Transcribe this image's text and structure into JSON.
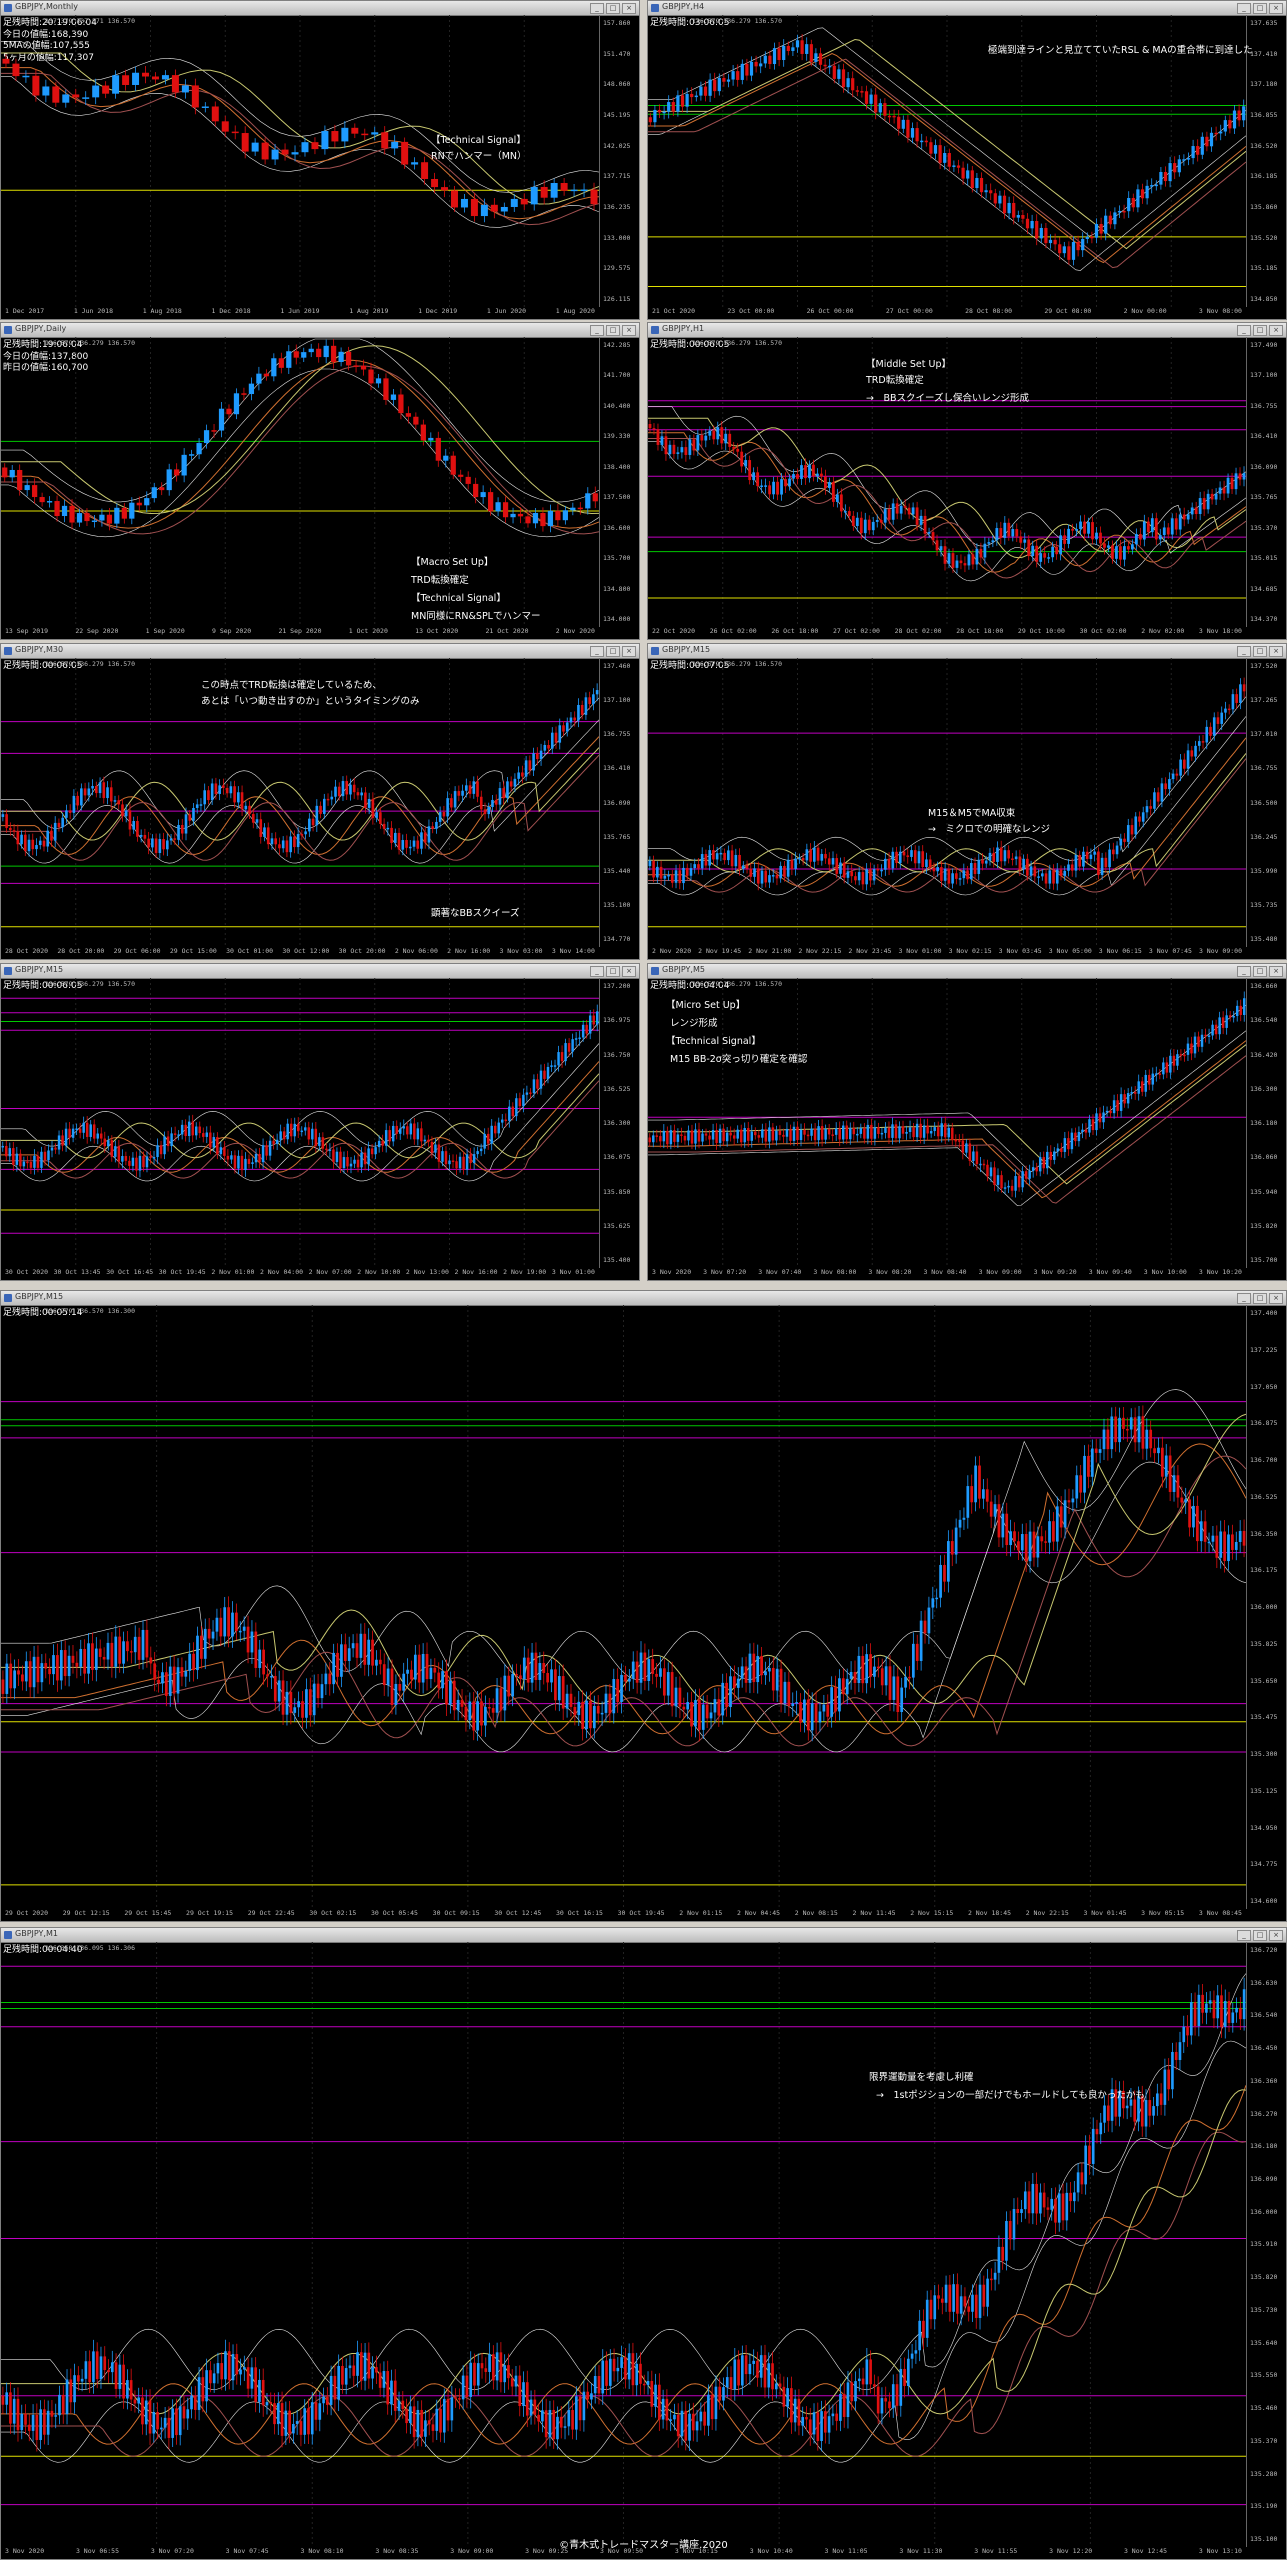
{
  "panels": [
    {
      "id": "monthly",
      "title": "GBPJPY,Monthly",
      "info": [
        "足残時間:20:19:06:04",
        "今日の値幅:168,390",
        "5MAの値幅:107,555",
        "5ヶ月の値幅:117,307"
      ],
      "ohlc": "137.379 137.571 136.570",
      "x_labels": [
        "1 Dec 2017",
        "1 Jun 2018",
        "1 Aug 2018",
        "1 Dec 2018",
        "1 Jun 2019",
        "1 Aug 2019",
        "1 Dec 2019",
        "1 Jun 2020",
        "1 Aug 2020"
      ],
      "y_labels": [
        "157.860",
        "151.470",
        "148.060",
        "145.195",
        "142.025",
        "137.715",
        "136.235",
        "133.000",
        "129.575",
        "126.115"
      ],
      "notes": [
        "【Technical Signal】",
        "RNでハンマー（MN）"
      ]
    },
    {
      "id": "h4",
      "title": "GBPJPY,H4",
      "info": [
        "足残時間:03:06:05"
      ],
      "ohlc": "136.579 136.279 136.570",
      "x_labels": [
        "21 Oct 2020",
        "23 Oct 00:00",
        "26 Oct 00:00",
        "27 Oct 00:00",
        "28 Oct 08:00",
        "29 Oct 08:00",
        "2 Nov 00:00",
        "3 Nov 08:00"
      ],
      "y_labels": [
        "137.635",
        "137.410",
        "137.180",
        "136.855",
        "136.520",
        "136.185",
        "135.860",
        "135.520",
        "135.185",
        "134.850"
      ],
      "notes": [
        "極端到達ラインと見立てていたRSL & MAの重合帯に到達した"
      ]
    },
    {
      "id": "daily",
      "title": "GBPJPY,Daily",
      "info": [
        "足残時間:19:06:04",
        "今日の値幅:137,800",
        "昨日の値幅:160,700"
      ],
      "ohlc": "136.579 136.279 136.570",
      "x_labels": [
        "13 Sep 2019",
        "22 Sep 2020",
        "1 Sep 2020",
        "9 Sep 2020",
        "21 Sep 2020",
        "1 Oct 2020",
        "13 Oct 2020",
        "21 Oct 2020",
        "2 Nov 2020"
      ],
      "y_labels": [
        "142.285",
        "141.700",
        "140.400",
        "139.330",
        "138.400",
        "137.500",
        "136.600",
        "135.700",
        "134.800",
        "134.000"
      ],
      "notes": [
        "【Macro Set Up】",
        "TRD転換確定",
        "【Technical Signal】",
        "MN同様にRN&SPLでハンマー"
      ]
    },
    {
      "id": "h1",
      "title": "GBPJPY,H1",
      "info": [
        "足残時間:00:06:05"
      ],
      "ohlc": "136.579 136.279 136.570",
      "x_labels": [
        "22 Oct 2020",
        "26 Oct 02:00",
        "26 Oct 18:00",
        "27 Oct 02:00",
        "28 Oct 02:00",
        "28 Oct 18:00",
        "29 Oct 10:00",
        "30 Oct 02:00",
        "2 Nov 02:00",
        "3 Nov 18:00"
      ],
      "y_labels": [
        "137.490",
        "137.100",
        "136.755",
        "136.410",
        "136.090",
        "135.765",
        "135.370",
        "135.015",
        "134.685",
        "134.370"
      ],
      "notes": [
        "【Middle Set Up】",
        "TRD転換確定",
        "→　BBスクイーズし保合いレンジ形成"
      ]
    },
    {
      "id": "m30",
      "title": "GBPJPY,M30",
      "info": [
        "足残時間:00:06:05"
      ],
      "ohlc": "136.579 136.279 136.570",
      "x_labels": [
        "28 Oct 2020",
        "28 Oct 20:00",
        "29 Oct 06:00",
        "29 Oct 15:00",
        "30 Oct 01:00",
        "30 Oct 12:00",
        "30 Oct 20:00",
        "2 Nov 06:00",
        "2 Nov 16:00",
        "3 Nov 03:00",
        "3 Nov 14:00"
      ],
      "y_labels": [
        "137.460",
        "137.100",
        "136.755",
        "136.410",
        "136.090",
        "135.765",
        "135.440",
        "135.100",
        "134.770"
      ],
      "notes": [
        "この時点でTRD転換は確定しているため、",
        "あとは「いつ動き出すのか」というタイミングのみ",
        "顕著なBBスクイーズ"
      ]
    },
    {
      "id": "m15top",
      "title": "GBPJPY,M15",
      "info": [
        "足残時間:00:07:05"
      ],
      "ohlc": "136.579 136.279 136.570",
      "x_labels": [
        "2 Nov 2020",
        "2 Nov 19:45",
        "2 Nov 21:00",
        "2 Nov 22:15",
        "2 Nov 23:45",
        "3 Nov 01:00",
        "3 Nov 02:15",
        "3 Nov 03:45",
        "3 Nov 05:00",
        "3 Nov 06:15",
        "3 Nov 07:45",
        "3 Nov 09:00"
      ],
      "y_labels": [
        "137.520",
        "137.265",
        "137.010",
        "136.755",
        "136.500",
        "136.245",
        "135.990",
        "135.735",
        "135.480"
      ],
      "notes": [
        "M15＆M5でMA収束",
        "→　ミクロでの明確なレンジ"
      ]
    },
    {
      "id": "m15",
      "title": "GBPJPY,M15",
      "info": [
        "足残時間:00:06:05"
      ],
      "ohlc": "136.579 136.279 136.570",
      "x_labels": [
        "30 Oct 2020",
        "30 Oct 13:45",
        "30 Oct 16:45",
        "30 Oct 19:45",
        "2 Nov 01:00",
        "2 Nov 04:00",
        "2 Nov 07:00",
        "2 Nov 10:00",
        "2 Nov 13:00",
        "2 Nov 16:00",
        "2 Nov 19:00",
        "3 Nov 01:00"
      ],
      "y_labels": [
        "137.200",
        "136.975",
        "136.750",
        "136.525",
        "136.300",
        "136.075",
        "135.850",
        "135.625",
        "135.400"
      ],
      "notes": []
    },
    {
      "id": "m5",
      "title": "GBPJPY,M5",
      "info": [
        "足残時間:00:04:04"
      ],
      "ohlc": "136.579 136.279 136.570",
      "x_labels": [
        "3 Nov 2020",
        "3 Nov 07:20",
        "3 Nov 07:40",
        "3 Nov 08:00",
        "3 Nov 08:20",
        "3 Nov 08:40",
        "3 Nov 09:00",
        "3 Nov 09:20",
        "3 Nov 09:40",
        "3 Nov 10:00",
        "3 Nov 10:20"
      ],
      "y_labels": [
        "136.660",
        "136.540",
        "136.420",
        "136.300",
        "136.180",
        "136.060",
        "135.940",
        "135.820",
        "135.700"
      ],
      "notes": [
        "【Micro Set Up】",
        "レンジ形成",
        "【Technical Signal】",
        "M15 BB-2σ突っ切り確定を確認"
      ]
    },
    {
      "id": "m15big",
      "title": "GBPJPY,M15",
      "info": [
        "足残時間:00:05:14"
      ],
      "ohlc": "136.279 136.570 136.300",
      "x_labels": [
        "29 Oct 2020",
        "29 Oct 12:15",
        "29 Oct 15:45",
        "29 Oct 19:15",
        "29 Oct 22:45",
        "30 Oct 02:15",
        "30 Oct 05:45",
        "30 Oct 09:15",
        "30 Oct 12:45",
        "30 Oct 16:15",
        "30 Oct 19:45",
        "2 Nov 01:15",
        "2 Nov 04:45",
        "2 Nov 08:15",
        "2 Nov 11:45",
        "2 Nov 15:15",
        "2 Nov 18:45",
        "2 Nov 22:15",
        "3 Nov 01:45",
        "3 Nov 05:15",
        "3 Nov 08:45"
      ],
      "y_labels": [
        "137.400",
        "137.225",
        "137.050",
        "136.875",
        "136.700",
        "136.525",
        "136.350",
        "136.175",
        "136.000",
        "135.825",
        "135.650",
        "135.475",
        "135.300",
        "135.125",
        "134.950",
        "134.775",
        "134.600"
      ],
      "notes": []
    },
    {
      "id": "m1",
      "title": "GBPJPY,M1",
      "info": [
        "足残時間:00:04:40"
      ],
      "ohlc": "136.368 136.095 136.306",
      "x_labels": [
        "3 Nov 2020",
        "3 Nov 06:55",
        "3 Nov 07:20",
        "3 Nov 07:45",
        "3 Nov 08:10",
        "3 Nov 08:35",
        "3 Nov 09:00",
        "3 Nov 09:25",
        "3 Nov 09:50",
        "3 Nov 10:15",
        "3 Nov 10:40",
        "3 Nov 11:05",
        "3 Nov 11:30",
        "3 Nov 11:55",
        "3 Nov 12:20",
        "3 Nov 12:45",
        "3 Nov 13:10"
      ],
      "y_labels": [
        "136.720",
        "136.630",
        "136.540",
        "136.450",
        "136.360",
        "136.270",
        "136.180",
        "136.090",
        "136.000",
        "135.910",
        "135.820",
        "135.730",
        "135.640",
        "135.550",
        "135.460",
        "135.370",
        "135.280",
        "135.190",
        "135.100"
      ],
      "notes": [
        "限界運動量を考慮し利確",
        "→　1stポジションの一部だけでもホールドしても良かったかも"
      ]
    }
  ],
  "copyright": "©青木式トレードマスター講座.2020",
  "colors": {
    "bull": "#1e9bff",
    "bear": "#e01010",
    "magenta": "#c000c0",
    "yellow": "#e0e000",
    "green": "#00c800"
  }
}
